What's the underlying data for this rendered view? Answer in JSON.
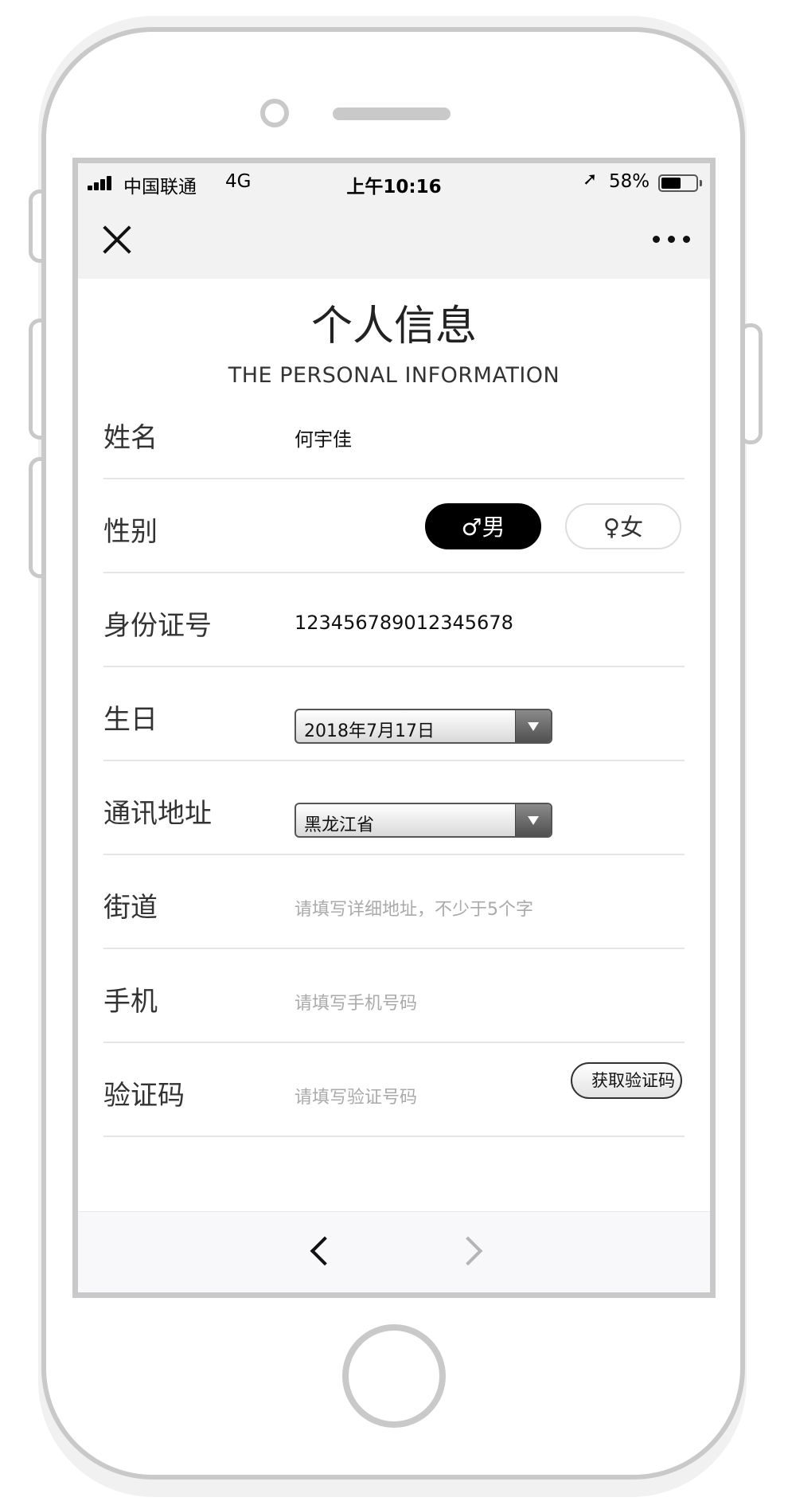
{
  "status_bar": {
    "carrier": "中国联通",
    "network": "4G",
    "time": "上午10:16",
    "location_icon": "➚",
    "battery_percent": "58%",
    "battery_level": 0.58
  },
  "nav": {
    "close_icon": "close-icon",
    "more_icon": "more-icon"
  },
  "header": {
    "title": "个人信息",
    "subtitle": "THE PERSONAL INFORMATION"
  },
  "form": {
    "name": {
      "label": "姓名",
      "value": "何宇佳"
    },
    "gender": {
      "label": "性别",
      "male_label": "♂男",
      "female_label": "♀女",
      "selected": "male"
    },
    "id_number": {
      "label": "身份证号",
      "value": "123456789012345678"
    },
    "birthday": {
      "label": "生日",
      "value": "2018年7月17日"
    },
    "address": {
      "label": "通讯地址",
      "value": "黑龙江省"
    },
    "street": {
      "label": "街道",
      "placeholder": "请填写详细地址，不少于5个字"
    },
    "phone": {
      "label": "手机",
      "placeholder": "请填写手机号码"
    },
    "code": {
      "label": "验证码",
      "placeholder": "请填写验证号码",
      "button": "获取验证码"
    }
  },
  "bottom_nav": {
    "back_icon": "chevron-left-icon",
    "forward_icon": "chevron-right-icon"
  },
  "colors": {
    "accent": "#000000",
    "placeholder": "#aaaaaa",
    "divider": "#e6e6e6"
  }
}
